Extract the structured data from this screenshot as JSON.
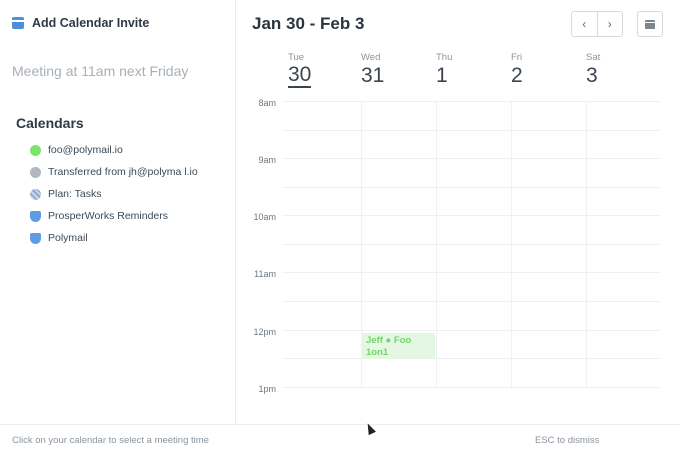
{
  "panel": {
    "title": "Add Calendar Invite",
    "meeting_input_value": "Meeting at 11am next Friday",
    "calendars_heading": "Calendars",
    "calendars": [
      {
        "label": "foo@polymail.io",
        "color": "#7be36b",
        "shape": "circle"
      },
      {
        "label": "Transferred from jh@polyma l.io",
        "color": "#b3b8be",
        "shape": "circle"
      },
      {
        "label": "Plan: Tasks",
        "color": "#9fb6d3",
        "shape": "striped"
      },
      {
        "label": "ProsperWorks Reminders",
        "color": "#5e9de4",
        "shape": "shield"
      },
      {
        "label": "Polymail",
        "color": "#5e9de4",
        "shape": "shield"
      }
    ]
  },
  "header": {
    "date_range": "Jan 30 - Feb 3",
    "prev_icon": "chevron-left-icon",
    "next_icon": "chevron-right-icon",
    "view_icon": "calendar-icon",
    "prev_label": "‹",
    "next_label": "›"
  },
  "days": [
    {
      "name": "Tue",
      "date": "30",
      "today": true
    },
    {
      "name": "Wed",
      "date": "31",
      "today": false
    },
    {
      "name": "Thu",
      "date": "1",
      "today": false
    },
    {
      "name": "Fri",
      "date": "2",
      "today": false
    },
    {
      "name": "Sat",
      "date": "3",
      "today": false
    }
  ],
  "hours": [
    "8am",
    "9am",
    "10am",
    "11am",
    "12pm",
    "1pm"
  ],
  "event": {
    "title": "Jeff ● Foo 1on1",
    "color": "#6fd66a"
  },
  "footer": {
    "hint": "Click on your calendar to select a meeting time",
    "dismiss": "ESC to dismiss"
  }
}
